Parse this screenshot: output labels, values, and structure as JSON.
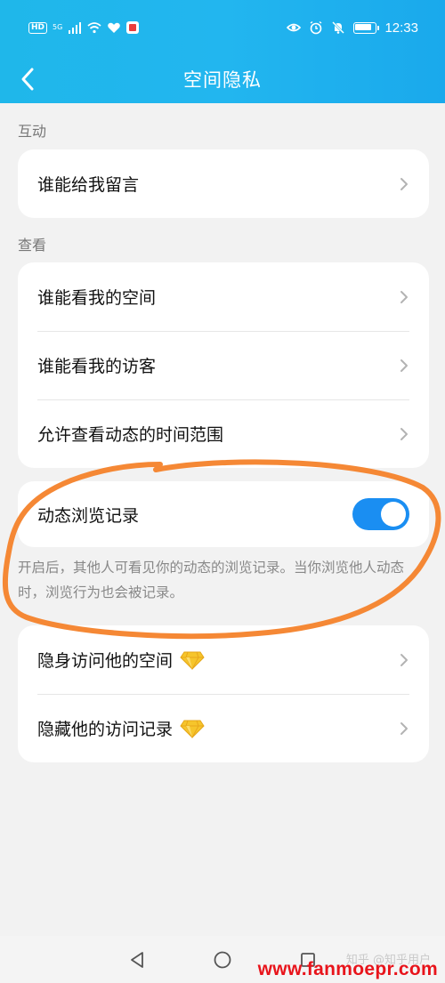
{
  "status_bar": {
    "hd": "HD",
    "signal": "5G",
    "time": "12:33"
  },
  "nav": {
    "title": "空间隐私",
    "back_icon": "chevron-left-icon"
  },
  "sections": {
    "interaction": {
      "label": "互动",
      "items": [
        {
          "label": "谁能给我留言"
        }
      ]
    },
    "view": {
      "label": "查看",
      "items": [
        {
          "label": "谁能看我的空间"
        },
        {
          "label": "谁能看我的访客"
        },
        {
          "label": "允许查看动态的时间范围"
        }
      ]
    },
    "browse_record": {
      "label": "动态浏览记录",
      "toggle_on": true,
      "description": "开启后，其他人可看见你的动态的浏览记录。当你浏览他人动态时，浏览行为也会被记录。"
    },
    "vip": {
      "items": [
        {
          "label": "隐身访问他的空间",
          "icon": "diamond-icon"
        },
        {
          "label": "隐藏他的访问记录",
          "icon": "diamond-icon"
        }
      ]
    }
  },
  "watermark": {
    "site": "www.fanmoepr.com",
    "faint": "知乎 @知乎用户"
  },
  "colors": {
    "header": "#1fb7ea",
    "toggle_on": "#1a8ef2",
    "annotation": "#f4822a",
    "watermark": "#e8141b"
  }
}
